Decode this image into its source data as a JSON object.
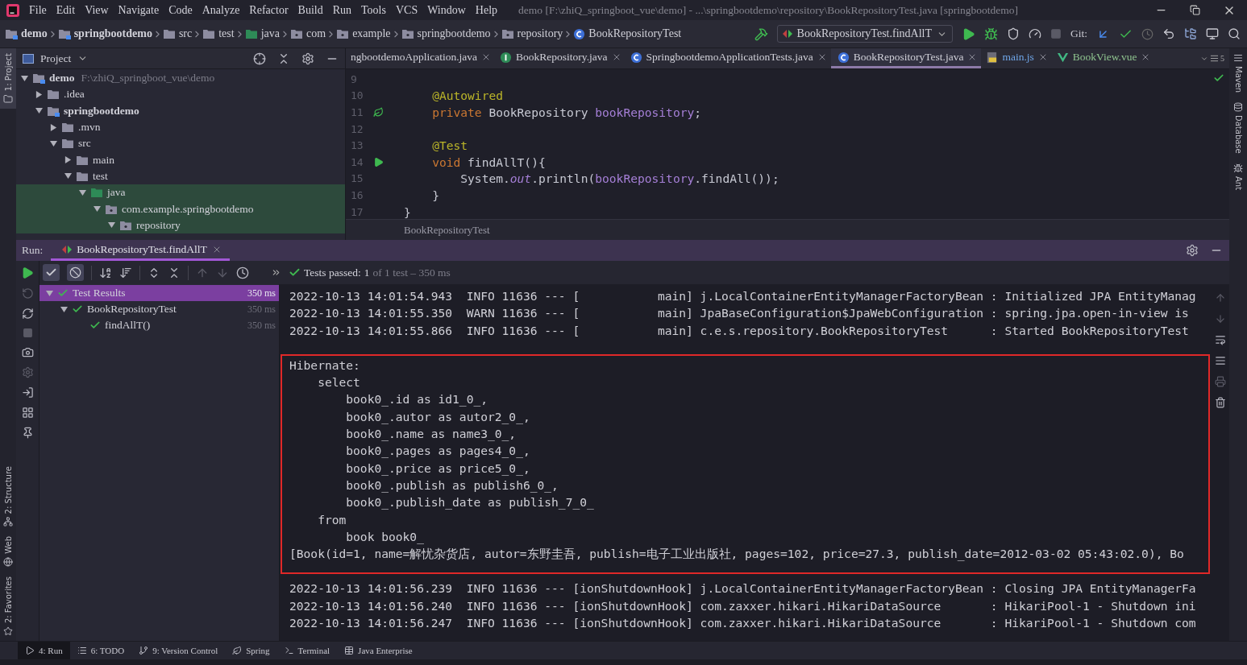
{
  "window": {
    "title": "demo [F:\\zhiQ_springboot_vue\\demo] - ...\\springbootdemo\\repository\\BookRepositoryTest.java [springbootdemo]"
  },
  "menu": [
    "File",
    "Edit",
    "View",
    "Navigate",
    "Code",
    "Analyze",
    "Refactor",
    "Build",
    "Run",
    "Tools",
    "VCS",
    "Window",
    "Help"
  ],
  "breadcrumbs": [
    {
      "label": "demo",
      "kind": "module"
    },
    {
      "label": "springbootdemo",
      "kind": "module"
    },
    {
      "label": "src",
      "kind": "folder"
    },
    {
      "label": "test",
      "kind": "folder"
    },
    {
      "label": "java",
      "kind": "test_root"
    },
    {
      "label": "com",
      "kind": "package"
    },
    {
      "label": "example",
      "kind": "package"
    },
    {
      "label": "springbootdemo",
      "kind": "package"
    },
    {
      "label": "repository",
      "kind": "package"
    },
    {
      "label": "BookRepositoryTest",
      "kind": "class"
    }
  ],
  "run_config": {
    "label": "BookRepositoryTest.findAllT"
  },
  "git": {
    "label": "Git:"
  },
  "left_stripe": [
    {
      "label": "1: Project",
      "kind": "project",
      "selected": true
    },
    {
      "label": "2: Structure",
      "kind": "structure",
      "selected": false
    },
    {
      "label": "Web",
      "kind": "web",
      "selected": false
    },
    {
      "label": "2: Favorites",
      "kind": "favorites",
      "selected": false
    }
  ],
  "right_stripe": [
    {
      "label": "Maven",
      "kind": "maven"
    },
    {
      "label": "Database",
      "kind": "database"
    },
    {
      "label": "Ant",
      "kind": "ant"
    }
  ],
  "project": {
    "title": "Project",
    "tree": [
      {
        "label": "demo",
        "path": "F:\\zhiQ_springboot_vue\\demo",
        "kind": "module",
        "expanded": true,
        "test_scope": false,
        "children": [
          {
            "label": ".idea",
            "kind": "folder",
            "expanded": false,
            "test_scope": false
          },
          {
            "label": "springbootdemo",
            "kind": "module",
            "expanded": true,
            "test_scope": false,
            "children": [
              {
                "label": ".mvn",
                "kind": "folder",
                "expanded": false,
                "test_scope": false
              },
              {
                "label": "src",
                "kind": "folder",
                "expanded": true,
                "test_scope": false,
                "children": [
                  {
                    "label": "main",
                    "kind": "folder",
                    "expanded": false,
                    "test_scope": false
                  },
                  {
                    "label": "test",
                    "kind": "folder",
                    "expanded": true,
                    "test_scope": false,
                    "children": [
                      {
                        "label": "java",
                        "kind": "test_root",
                        "expanded": true,
                        "test_scope": true,
                        "children": [
                          {
                            "label": "com.example.springbootdemo",
                            "kind": "package",
                            "expanded": true,
                            "test_scope": true,
                            "children": [
                              {
                                "label": "repository",
                                "kind": "package",
                                "expanded": true,
                                "test_scope": true
                              }
                            ]
                          }
                        ]
                      }
                    ]
                  }
                ]
              }
            ]
          }
        ]
      }
    ]
  },
  "tabs": [
    {
      "label": "ngbootdemoApplication.java",
      "kind": "text",
      "selected": false
    },
    {
      "label": "BookRepository.java",
      "kind": "interface",
      "selected": false
    },
    {
      "label": "SpringbootdemoApplicationTests.java",
      "kind": "class",
      "selected": false
    },
    {
      "label": "BookRepositoryTest.java",
      "kind": "class",
      "selected": true
    },
    {
      "label": "main.js",
      "kind": "js",
      "selected": false
    },
    {
      "label": "BookView.vue",
      "kind": "vue",
      "selected": false
    }
  ],
  "hidden_tabs": "5",
  "editor": {
    "lines": [
      {
        "number": "9"
      },
      {
        "number": "10",
        "tokens": [
          {
            "text": "    @Autowired",
            "kind": "annotation"
          }
        ]
      },
      {
        "number": "11",
        "kind": "bean",
        "tokens": [
          {
            "text": "    private",
            "kind": "keyword"
          },
          {
            "text": " BookRepository ",
            "kind": "plain"
          },
          {
            "text": "bookRepository",
            "kind": "field"
          },
          {
            "text": ";",
            "kind": "plain"
          }
        ]
      },
      {
        "number": "12"
      },
      {
        "number": "13",
        "tokens": [
          {
            "text": "    @Test",
            "kind": "annotation"
          }
        ]
      },
      {
        "number": "14",
        "kind": "run",
        "tokens": [
          {
            "text": "    void",
            "kind": "keyword"
          },
          {
            "text": " findAllT(){",
            "kind": "plain"
          }
        ]
      },
      {
        "number": "15",
        "tokens": [
          {
            "text": "        System.",
            "kind": "plain"
          },
          {
            "text": "out",
            "kind": "static"
          },
          {
            "text": ".println(",
            "kind": "plain"
          },
          {
            "text": "bookRepository",
            "kind": "field"
          },
          {
            "text": ".findAll());",
            "kind": "plain"
          }
        ]
      },
      {
        "number": "16",
        "tokens": [
          {
            "text": "    }",
            "kind": "plain"
          }
        ]
      },
      {
        "number": "17",
        "tokens": [
          {
            "text": "}",
            "kind": "plain"
          }
        ]
      }
    ],
    "breadcrumb": "BookRepositoryTest"
  },
  "run": {
    "label": "Run:",
    "tab": "BookRepositoryTest.findAllT",
    "status": {
      "label": "Tests passed:",
      "count": "1",
      "detail": "of 1 test – 350 ms"
    },
    "tests": [
      {
        "label": "Test Results",
        "time": "350 ms",
        "expanded": true,
        "selected": true,
        "passed": true,
        "children": [
          {
            "label": "BookRepositoryTest",
            "time": "350 ms",
            "expanded": true,
            "selected": false,
            "passed": true,
            "children": [
              {
                "label": "findAllT()",
                "time": "350 ms",
                "selected": false,
                "passed": true
              }
            ]
          }
        ]
      }
    ],
    "console": {
      "before": [
        "2022-10-13 14:01:54.943  INFO 11636 --- [           main] j.LocalContainerEntityManagerFactoryBean : Initialized JPA EntityManag",
        "2022-10-13 14:01:55.350  WARN 11636 --- [           main] JpaBaseConfiguration$JpaWebConfiguration : spring.jpa.open-in-view is",
        "2022-10-13 14:01:55.866  INFO 11636 --- [           main] c.e.s.repository.BookRepositoryTest      : Started BookRepositoryTest"
      ],
      "highlighted": [
        "Hibernate: ",
        "    select",
        "        book0_.id as id1_0_,",
        "        book0_.autor as autor2_0_,",
        "        book0_.name as name3_0_,",
        "        book0_.pages as pages4_0_,",
        "        book0_.price as price5_0_,",
        "        book0_.publish as publish6_0_,",
        "        book0_.publish_date as publish_7_0_ ",
        "    from",
        "        book book0_",
        "[Book(id=1, name=解忧杂货店, autor=东野圭吾, publish=电子工业出版社, pages=102, price=27.3, publish_date=2012-03-02 05:43:02.0), Bo"
      ],
      "after": [
        "2022-10-13 14:01:56.239  INFO 11636 --- [ionShutdownHook] j.LocalContainerEntityManagerFactoryBean : Closing JPA EntityManagerFa",
        "2022-10-13 14:01:56.240  INFO 11636 --- [ionShutdownHook] com.zaxxer.hikari.HikariDataSource       : HikariPool-1 - Shutdown ini",
        "2022-10-13 14:01:56.247  INFO 11636 --- [ionShutdownHook] com.zaxxer.hikari.HikariDataSource       : HikariPool-1 - Shutdown com"
      ]
    }
  },
  "bottom_tools": [
    {
      "label": "4: Run",
      "kind": "run",
      "selected": true
    },
    {
      "label": "6: TODO",
      "kind": "todo",
      "selected": false
    },
    {
      "label": "9: Version Control",
      "kind": "vcs",
      "selected": false
    },
    {
      "label": "Spring",
      "kind": "spring",
      "selected": false
    },
    {
      "label": "Terminal",
      "kind": "terminal",
      "selected": false
    },
    {
      "label": "Java Enterprise",
      "kind": "enterprise",
      "selected": false
    }
  ]
}
